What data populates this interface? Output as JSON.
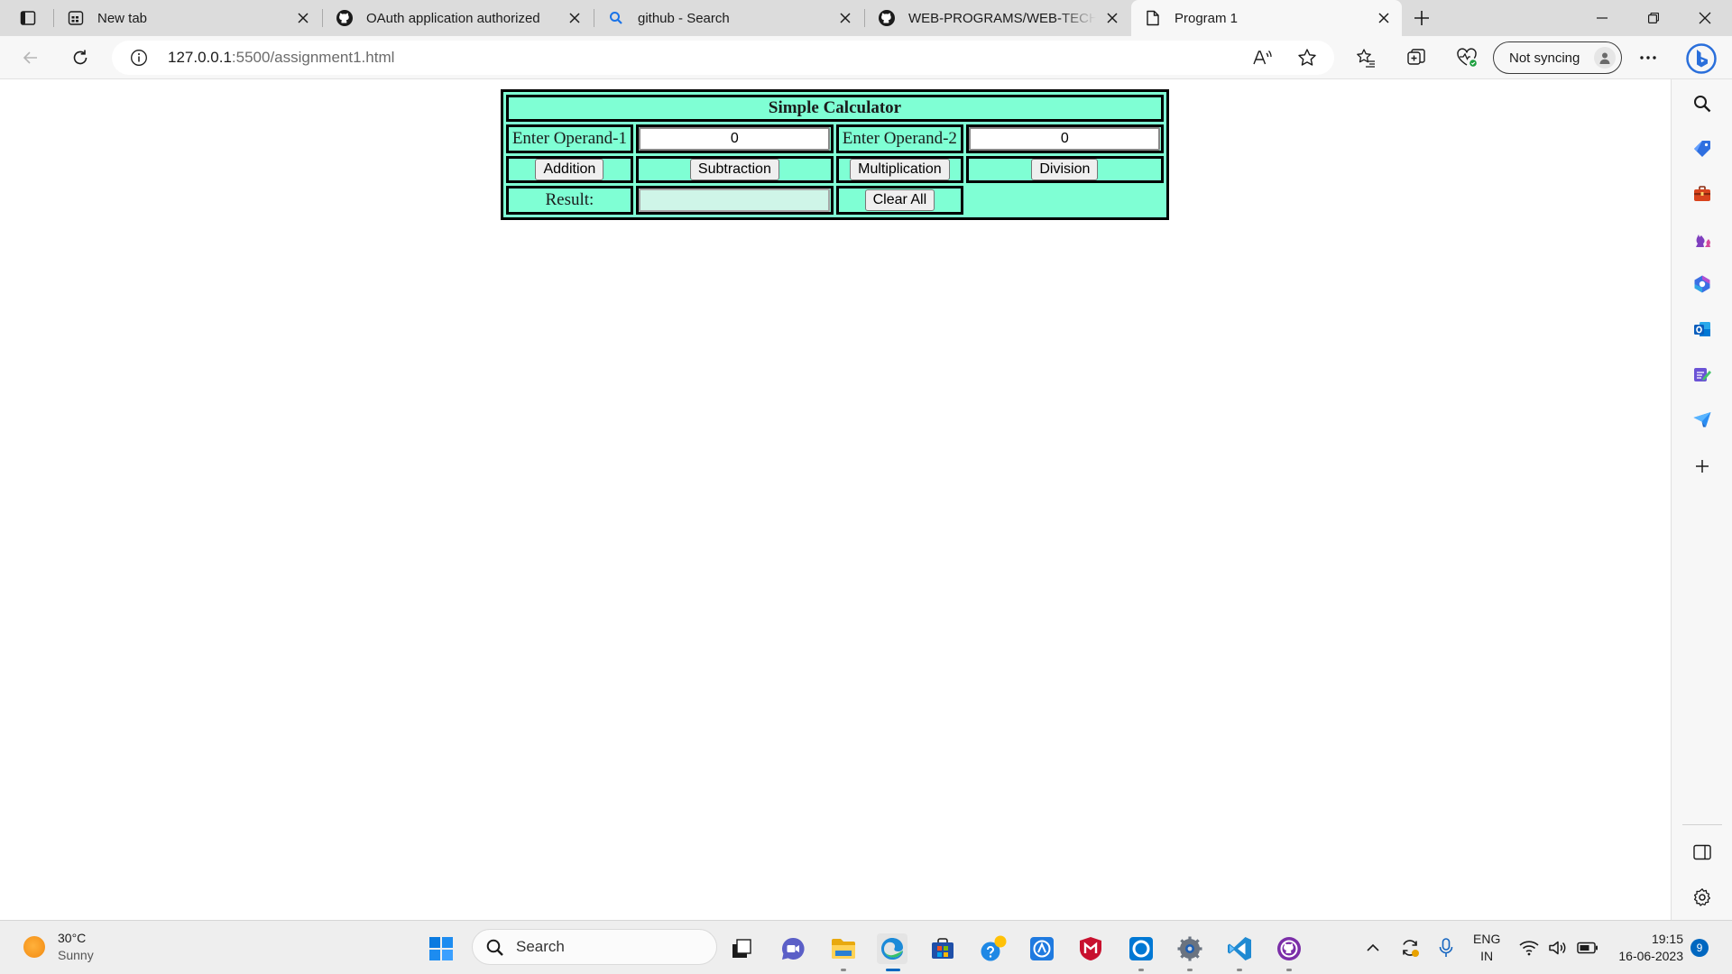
{
  "browser": {
    "tabs": [
      {
        "title": "New tab",
        "icon": "new-tab-page-icon"
      },
      {
        "title": "OAuth application authorized",
        "icon": "github-icon"
      },
      {
        "title": "github - Search",
        "icon": "search-icon"
      },
      {
        "title": "WEB-PROGRAMS/WEB-TECHNO",
        "icon": "github-icon"
      },
      {
        "title": "Program 1",
        "icon": "page-icon",
        "active": true
      }
    ],
    "address": {
      "host": "127.0.0.1",
      "path": ":5500/assignment1.html"
    },
    "sync_label": "Not syncing"
  },
  "calculator": {
    "title": "Simple Calculator",
    "operand1_label": "Enter Operand-1",
    "operand1_value": "0",
    "operand2_label": "Enter Operand-2",
    "operand2_value": "0",
    "addition_label": "Addition",
    "subtraction_label": "Subtraction",
    "multiplication_label": "Multiplication",
    "division_label": "Division",
    "result_label": "Result:",
    "result_value": "",
    "clear_label": "Clear All"
  },
  "taskbar": {
    "weather_temp": "30°C",
    "weather_desc": "Sunny",
    "search_placeholder": "Search",
    "lang_line1": "ENG",
    "lang_line2": "IN",
    "time": "19:15",
    "date": "16-06-2023",
    "notification_count": "9"
  },
  "colors": {
    "calculator_bg": "#7fffd4",
    "border": "#000000",
    "accent": "#0067c0"
  }
}
